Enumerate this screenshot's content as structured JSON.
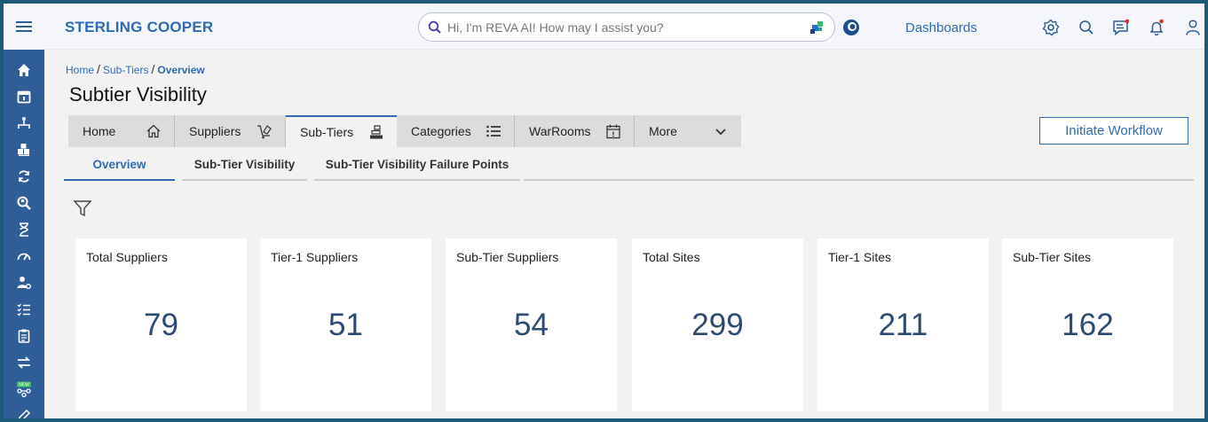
{
  "app": {
    "brand": "STERLING COOPER"
  },
  "search": {
    "placeholder": "Hi, I'm REVA AI! How may I assist you?"
  },
  "header": {
    "dashboards_label": "Dashboards"
  },
  "breadcrumb": {
    "items": [
      "Home",
      "Sub-Tiers",
      "Overview"
    ],
    "separator": "/"
  },
  "page": {
    "title": "Subtier Visibility"
  },
  "tabs": [
    {
      "label": "Home",
      "icon": "home-icon"
    },
    {
      "label": "Suppliers",
      "icon": "suppliers-icon"
    },
    {
      "label": "Sub-Tiers",
      "icon": "sub-tiers-icon"
    },
    {
      "label": "Categories",
      "icon": "list-icon"
    },
    {
      "label": "WarRooms",
      "icon": "calendar-icon"
    },
    {
      "label": "More",
      "icon": "chevron-down-icon"
    }
  ],
  "actions": {
    "initiate_workflow": "Initiate Workflow"
  },
  "subtabs": [
    "Overview",
    "Sub-Tier Visibility",
    "Sub-Tier Visibility Failure Points"
  ],
  "cards": [
    {
      "label": "Total Suppliers",
      "value": "79"
    },
    {
      "label": "Tier-1 Suppliers",
      "value": "51"
    },
    {
      "label": "Sub-Tier Suppliers",
      "value": "54"
    },
    {
      "label": "Total Sites",
      "value": "299"
    },
    {
      "label": "Tier-1 Sites",
      "value": "211"
    },
    {
      "label": "Sub-Tier Sites",
      "value": "162"
    }
  ],
  "colors": {
    "accent": "#2f6bb3",
    "sidebar": "#2f5d98",
    "value": "#2d4a72",
    "notification": "#e0312f"
  },
  "sidebar_icons": [
    "home-icon",
    "calendar-icon",
    "hierarchy-icon",
    "boxes-icon",
    "refresh-icon",
    "search-user-icon",
    "hourglass-icon",
    "gauge-icon",
    "user-settings-icon",
    "checklist-icon",
    "clipboard-icon",
    "transfer-icon",
    "new-network-icon",
    "edit-icon"
  ]
}
